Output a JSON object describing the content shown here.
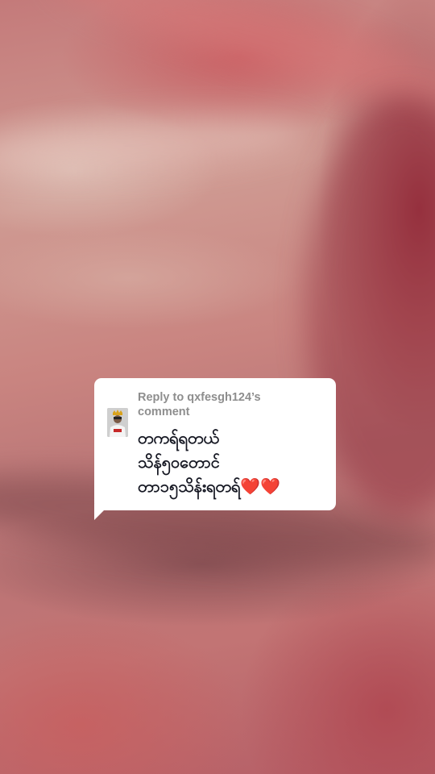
{
  "reply": {
    "label": "Reply to qxfesgh124's comment",
    "label_line1": "Reply to qxfesgh124’s",
    "label_line2": "comment"
  },
  "comment": {
    "line1": "တကရ်ရတယ်",
    "line2": "သိန်၅ဝတောင်",
    "line3": "တာ၁၅သိန်းရတရ်",
    "emoji": "❤️❤️"
  },
  "avatar": {
    "icon": "user-avatar"
  },
  "colors": {
    "bubble": "#ffffff",
    "reply_label": "#8e8e8e",
    "comment_text": "#161823",
    "heart": "#e3162b"
  }
}
